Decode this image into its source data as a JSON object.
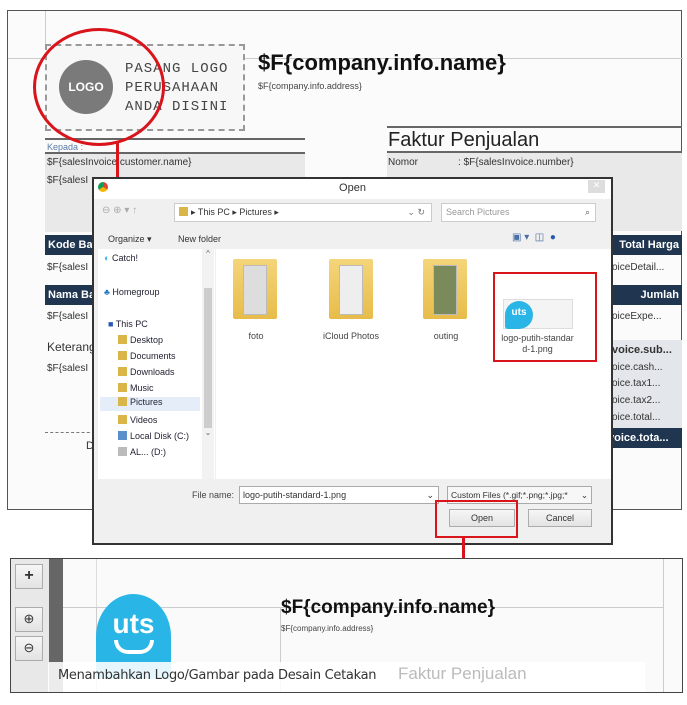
{
  "designer": {
    "logo_placeholder": "LOGO",
    "logo_text": [
      "PASANG LOGO",
      "PERUSAHAAN",
      "ANDA DISINI"
    ],
    "company_name": "$F{company.info.name}",
    "company_address": "$F{company.info.address}",
    "invoice_title": "Faktur Penjualan",
    "kepada": "Kepada :",
    "customer_name": "$F{salesInvoice.customer.name}",
    "customer_line2": "$F{salesI",
    "nomor_label": "Nomor",
    "nomor_value": ": $F{salesInvoice.number}",
    "kode_header": "Kode Ba",
    "total_harga": "Total Harga",
    "row1_left": "$F{salesI",
    "row1_right": "oiceDetail...",
    "nama_header": "Nama Ba",
    "jumlah": "Jumlah",
    "row2_left": "$F{salesI",
    "row2_right": "oiceExpe...",
    "keterangan": "Keterang",
    "row3_left": "$F{salesI",
    "totals": [
      "voice.sub...",
      "oice.cash...",
      "oice.tax1...",
      "oice.tax2...",
      "oice.total..."
    ],
    "grand_total": "voice.tota...",
    "footer_d": "D"
  },
  "dialog": {
    "title": "Open",
    "breadcrumb": [
      "This PC",
      "Pictures"
    ],
    "search_placeholder": "Search Pictures",
    "organize": "Organize ▾",
    "new_folder": "New folder",
    "nav": [
      "Catch!",
      "Homegroup",
      "This PC",
      "Desktop",
      "Documents",
      "Downloads",
      "Music",
      "Pictures",
      "Videos",
      "Local Disk (C:)",
      "AL... (D:)"
    ],
    "files": [
      "foto",
      "iCloud Photos",
      "outing",
      "logo-putih-standard-1.png"
    ],
    "file_name_label": "File name:",
    "file_name_value": "logo-putih-standard-1.png",
    "filter": "Custom Files (*.gif;*.png;*.jpg;*",
    "open": "Open",
    "cancel": "Cancel"
  },
  "result": {
    "logo_text": "uts",
    "company_name": "$F{company.info.name}",
    "company_address": "$F{company.info.address}",
    "invoice_title": "Faktur Penjualan",
    "toolbar": [
      "+",
      "zoom-in",
      "zoom-out"
    ]
  },
  "caption": "Menambahkan Logo/Gambar pada Desain Cetakan",
  "colors": {
    "highlight": "#d9141b",
    "header": "#1f3550",
    "brand": "#29b6e6"
  }
}
